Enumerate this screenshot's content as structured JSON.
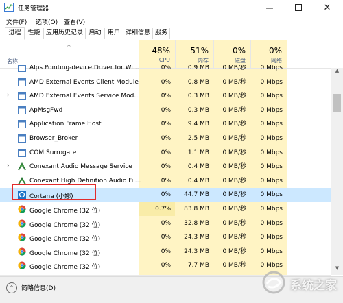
{
  "window": {
    "title": "任务管理器"
  },
  "menu": [
    "文件(F)",
    "选项(O)",
    "查看(V)"
  ],
  "tabs": [
    "进程",
    "性能",
    "应用历史记录",
    "启动",
    "用户",
    "详细信息",
    "服务"
  ],
  "header": {
    "name_label": "名称",
    "cpu": {
      "pct": "48%",
      "label": "CPU"
    },
    "mem": {
      "pct": "51%",
      "label": "内存"
    },
    "disk": {
      "pct": "0%",
      "label": "磁盘"
    },
    "net": {
      "pct": "0%",
      "label": "网络"
    }
  },
  "rows": [
    {
      "name": "Alps Pointing-device Driver for Wi...",
      "cpu": "0%",
      "mem": "0.9 MB",
      "disk": "0 MB/秒",
      "net": "0 Mbps",
      "icon": "app-icon",
      "expandable": false
    },
    {
      "name": "AMD External Events Client Module",
      "cpu": "0%",
      "mem": "0.8 MB",
      "disk": "0 MB/秒",
      "net": "0 Mbps",
      "icon": "app-icon",
      "expandable": false
    },
    {
      "name": "AMD External Events Service Mod...",
      "cpu": "0%",
      "mem": "0.3 MB",
      "disk": "0 MB/秒",
      "net": "0 Mbps",
      "icon": "app-icon",
      "expandable": true
    },
    {
      "name": "ApMsgFwd",
      "cpu": "0%",
      "mem": "0.3 MB",
      "disk": "0 MB/秒",
      "net": "0 Mbps",
      "icon": "app-icon",
      "expandable": false
    },
    {
      "name": "Application Frame Host",
      "cpu": "0%",
      "mem": "9.4 MB",
      "disk": "0 MB/秒",
      "net": "0 Mbps",
      "icon": "app-icon",
      "expandable": false
    },
    {
      "name": "Browser_Broker",
      "cpu": "0%",
      "mem": "2.5 MB",
      "disk": "0 MB/秒",
      "net": "0 Mbps",
      "icon": "app-icon",
      "expandable": false
    },
    {
      "name": "COM Surrogate",
      "cpu": "0%",
      "mem": "1.1 MB",
      "disk": "0 MB/秒",
      "net": "0 Mbps",
      "icon": "app-icon",
      "expandable": false
    },
    {
      "name": "Conexant Audio Message Service",
      "cpu": "0%",
      "mem": "0.4 MB",
      "disk": "0 MB/秒",
      "net": "0 Mbps",
      "icon": "conexant-icon",
      "expandable": true
    },
    {
      "name": "Conexant High Definition Audio Fil...",
      "cpu": "0%",
      "mem": "0.4 MB",
      "disk": "0 MB/秒",
      "net": "0 Mbps",
      "icon": "conexant-icon",
      "expandable": false
    },
    {
      "name": "Cortana (小娜)",
      "cpu": "0%",
      "mem": "44.7 MB",
      "disk": "0 MB/秒",
      "net": "0 Mbps",
      "icon": "cortana-icon",
      "expandable": false,
      "selected": true
    },
    {
      "name": "Google Chrome (32 位)",
      "cpu": "0.7%",
      "mem": "83.8 MB",
      "disk": "0 MB/秒",
      "net": "0 Mbps",
      "icon": "chrome-icon",
      "expandable": false
    },
    {
      "name": "Google Chrome (32 位)",
      "cpu": "0%",
      "mem": "32.8 MB",
      "disk": "0 MB/秒",
      "net": "0 Mbps",
      "icon": "chrome-icon",
      "expandable": false
    },
    {
      "name": "Google Chrome (32 位)",
      "cpu": "0%",
      "mem": "24.3 MB",
      "disk": "0 MB/秒",
      "net": "0 Mbps",
      "icon": "chrome-icon",
      "expandable": false
    },
    {
      "name": "Google Chrome (32 位)",
      "cpu": "0%",
      "mem": "24.3 MB",
      "disk": "0 MB/秒",
      "net": "0 Mbps",
      "icon": "chrome-icon",
      "expandable": false
    },
    {
      "name": "Google Chrome (32 位)",
      "cpu": "0%",
      "mem": "7.7 MB",
      "disk": "0 MB/秒",
      "net": "0 Mbps",
      "icon": "chrome-icon",
      "expandable": false
    }
  ],
  "footer": {
    "label": "简略信息(D)"
  },
  "watermark": {
    "text": "系统之家"
  },
  "colors": {
    "cpu_col": "#fff4c4",
    "mem_col": "#fff4c4",
    "row_selected": "#cce8ff",
    "highlight": "#e22c2c",
    "cpu_hot": "#f9eca8"
  }
}
